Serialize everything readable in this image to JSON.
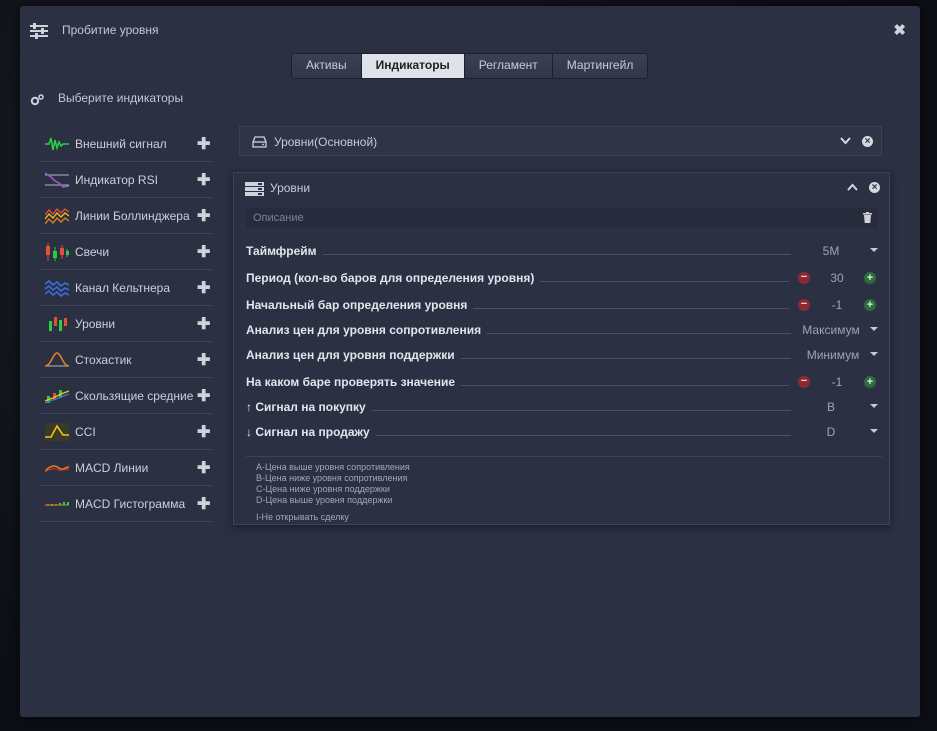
{
  "window": {
    "title": "Пробитие уровня",
    "close_glyph": "✖"
  },
  "tabs": [
    {
      "label": "Активы"
    },
    {
      "label": "Индикаторы",
      "active": true
    },
    {
      "label": "Регламент"
    },
    {
      "label": "Мартингейл"
    }
  ],
  "section": {
    "title": "Выберите индикаторы"
  },
  "indicators": [
    {
      "label": "Внешний сигнал",
      "icon": "external-signal-icon"
    },
    {
      "label": "Индикатор RSI",
      "icon": "rsi-icon"
    },
    {
      "label": "Линии Боллинджера",
      "icon": "bollinger-icon"
    },
    {
      "label": "Свечи",
      "icon": "candles-icon"
    },
    {
      "label": "Канал Кельтнера",
      "icon": "keltner-icon"
    },
    {
      "label": "Уровни",
      "icon": "levels-icon"
    },
    {
      "label": "Стохастик",
      "icon": "stochastic-icon"
    },
    {
      "label": "Скользящие средние",
      "icon": "moving-average-icon"
    },
    {
      "label": "CCI",
      "icon": "cci-icon"
    },
    {
      "label": "MACD Линии",
      "icon": "macd-lines-icon"
    },
    {
      "label": "MACD Гистограмма",
      "icon": "macd-histogram-icon"
    }
  ],
  "collapsed_panel": {
    "title": "Уровни(Основной)"
  },
  "panel": {
    "title": "Уровни",
    "description_placeholder": "Описание",
    "rows": [
      {
        "label": "Таймфрейм",
        "value": "5M"
      },
      {
        "label": "Период (кол-во баров для определения уровня)",
        "value": "30"
      },
      {
        "label": "Начальный бар определения уровня",
        "value": "-1"
      },
      {
        "label": "Анализ цен для уровня сопротивления",
        "value": "Максимум"
      },
      {
        "label": "Анализ цен для уровня поддержки",
        "value": "Минимум"
      },
      {
        "label": "На каком баре проверять значение",
        "value": "-1"
      },
      {
        "label": "↑ Сигнал на покупку",
        "value": "B"
      },
      {
        "label": "↓ Сигнал на продажу",
        "value": "D"
      }
    ],
    "legend": [
      "A-Цена выше уровня сопротивления",
      "B-Цена ниже уровня сопротивления",
      "C-Цена ниже уровня поддержки",
      "D-Цена выше уровня поддержки"
    ],
    "legend_extra": "I-Не открывать сделку"
  },
  "colors": {
    "window_bg": "#2b3043",
    "minus": "#8b2a34",
    "plus": "#2e6b3d",
    "active_tab": "#dfe2e8"
  }
}
